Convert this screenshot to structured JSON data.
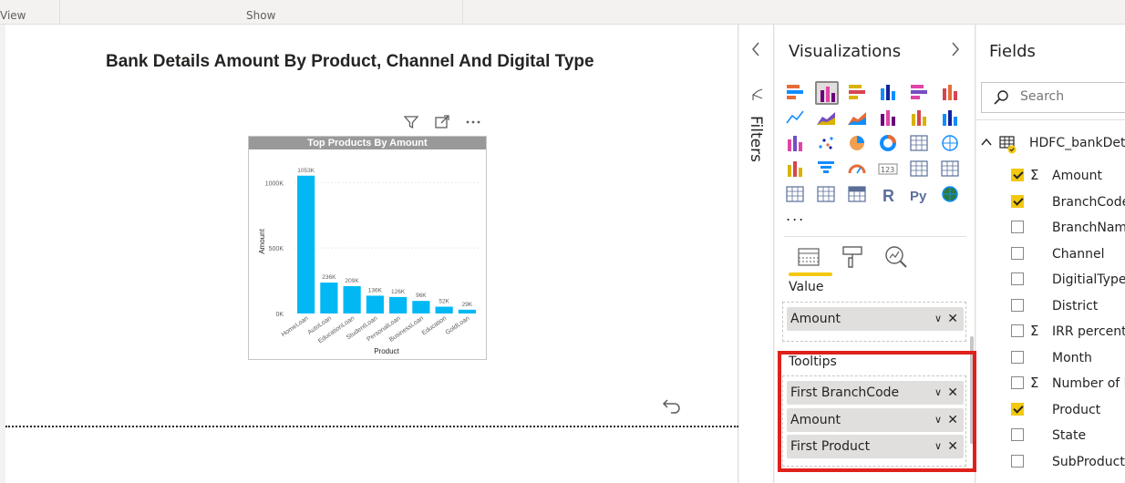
{
  "ribbon": {
    "view_label": "View",
    "show_label": "Show"
  },
  "report": {
    "title": "Bank Details Amount By Product, Channel And Digital Type"
  },
  "visual": {
    "title": "Top Products By Amount",
    "header_icons": [
      "filter-icon",
      "focus-mode-icon",
      "more-options-icon"
    ]
  },
  "chart_data": {
    "type": "bar",
    "title": "Top Products By Amount",
    "xlabel": "Product",
    "ylabel": "Amount",
    "categories": [
      "HomeLoan",
      "AutoLoan",
      "EducationLoan",
      "StudentLoan",
      "PersonalLoan",
      "BusinessLoan",
      "Education",
      "GoldLoan"
    ],
    "values": [
      1053,
      236,
      209,
      136,
      126,
      96,
      52,
      29
    ],
    "data_labels": [
      "1053K",
      "236K",
      "209K",
      "136K",
      "126K",
      "96K",
      "52K",
      "29K"
    ],
    "yticks": [
      0,
      500,
      1000
    ],
    "ytick_labels": [
      "0K",
      "500K",
      "1000K"
    ],
    "ylim": [
      0,
      1100
    ],
    "grid": true,
    "bar_color": "#01b8f5"
  },
  "filters": {
    "label": "Filters"
  },
  "visualizations": {
    "title": "Visualizations",
    "more": "...",
    "icons": [
      "stacked-bar-icon",
      "stacked-column-icon",
      "clustered-bar-icon",
      "clustered-column-icon",
      "100-stacked-bar-icon",
      "100-stacked-column-icon",
      "line-chart-icon",
      "area-chart-icon",
      "stacked-area-icon",
      "line-column-icon",
      "line-clustered-column-icon",
      "ribbon-chart-icon",
      "waterfall-icon",
      "scatter-icon",
      "pie-icon",
      "donut-icon",
      "treemap-icon",
      "map-icon",
      "filled-map-icon",
      "funnel-icon",
      "gauge-icon",
      "card-icon",
      "multi-row-card-icon",
      "kpi-icon",
      "slicer-icon",
      "table-icon",
      "matrix-icon",
      "r-visual-icon",
      "python-visual-icon",
      "arcgis-icon"
    ],
    "selected_icon": "stacked-column-icon",
    "value_label": "Value",
    "value_fields": [
      "Amount"
    ],
    "tooltips_label": "Tooltips",
    "tooltip_fields": [
      "First BranchCode",
      "Amount",
      "First Product"
    ]
  },
  "fields": {
    "title": "Fields",
    "search_placeholder": "Search",
    "table_name": "HDFC_bankDetails",
    "items": [
      {
        "label": "Amount",
        "sigma": true,
        "checked": true
      },
      {
        "label": "BranchCode",
        "sigma": false,
        "checked": true
      },
      {
        "label": "BranchName",
        "sigma": false,
        "checked": false
      },
      {
        "label": "Channel",
        "sigma": false,
        "checked": false
      },
      {
        "label": "DigitialType",
        "sigma": false,
        "checked": false
      },
      {
        "label": "District",
        "sigma": false,
        "checked": false
      },
      {
        "label": "IRR percentage",
        "sigma": true,
        "checked": false
      },
      {
        "label": "Month",
        "sigma": false,
        "checked": false
      },
      {
        "label": "Number of loans",
        "sigma": true,
        "checked": false
      },
      {
        "label": "Product",
        "sigma": false,
        "checked": true
      },
      {
        "label": "State",
        "sigma": false,
        "checked": false
      },
      {
        "label": "SubProduct",
        "sigma": false,
        "checked": false
      }
    ]
  },
  "colors": {
    "accent": "#f2c811",
    "highlight": "#e0201b",
    "bar": "#01b8f5"
  }
}
